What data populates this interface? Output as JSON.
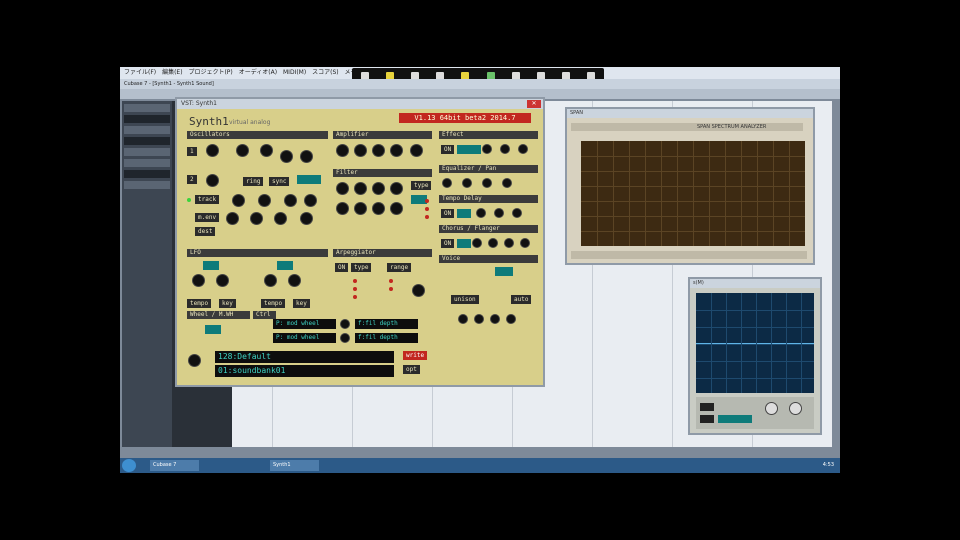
{
  "host": {
    "menu": [
      "ファイル(F)",
      "編集(E)",
      "プロジェクト(P)",
      "オーディオ(A)",
      "MIDI(M)",
      "スコア(S)",
      "メディア(D)"
    ],
    "toolbar_label": "Cubase 7 - [Synth1 - Synth1 Sound]"
  },
  "synth": {
    "window_title": "VST: Synth1",
    "logo": "Synth1",
    "subtitle": "virtual analog",
    "version": "V1.13 64bit beta2 2014.7",
    "sections": {
      "oscillators": "Oscillators",
      "amplifier": "Amplifier",
      "effect": "Effect",
      "filter": "Filter",
      "equalizer": "Equalizer / Pan",
      "tempo_delay": "Tempo Delay",
      "chorus": "Chorus / Flanger",
      "lfo": "LFO",
      "arpeggiator": "Arpeggiator",
      "voice": "Voice",
      "wheel": "Wheel / M.WH",
      "ctrl": "Ctrl"
    },
    "buttons": {
      "ring": "ring",
      "sync": "sync",
      "track": "track",
      "mod_env": "m.env",
      "dest": "dest",
      "type": "type",
      "on": "ON",
      "range": "range",
      "tempo1": "tempo",
      "key1": "key",
      "tempo2": "tempo",
      "key2": "key",
      "auto": "auto",
      "unison": "unison",
      "write": "write",
      "opt": "opt"
    },
    "ctrl_dest1": "P: mod wheel",
    "ctrl_dest2": "P: mod wheel",
    "ctrl_val1": "f:fil depth",
    "ctrl_val2": "f:fil depth",
    "patch_display": "128:Default",
    "bank_display": "01:soundbank01"
  },
  "spectrum": {
    "window_title": "SPAN",
    "header_text": "SPAN SPECTRUM ANALYZER"
  },
  "scope": {
    "window_title": "s(M)"
  },
  "taskbar": {
    "items": [
      "Cubase 7",
      "Synth1"
    ],
    "clock": "4:53"
  }
}
